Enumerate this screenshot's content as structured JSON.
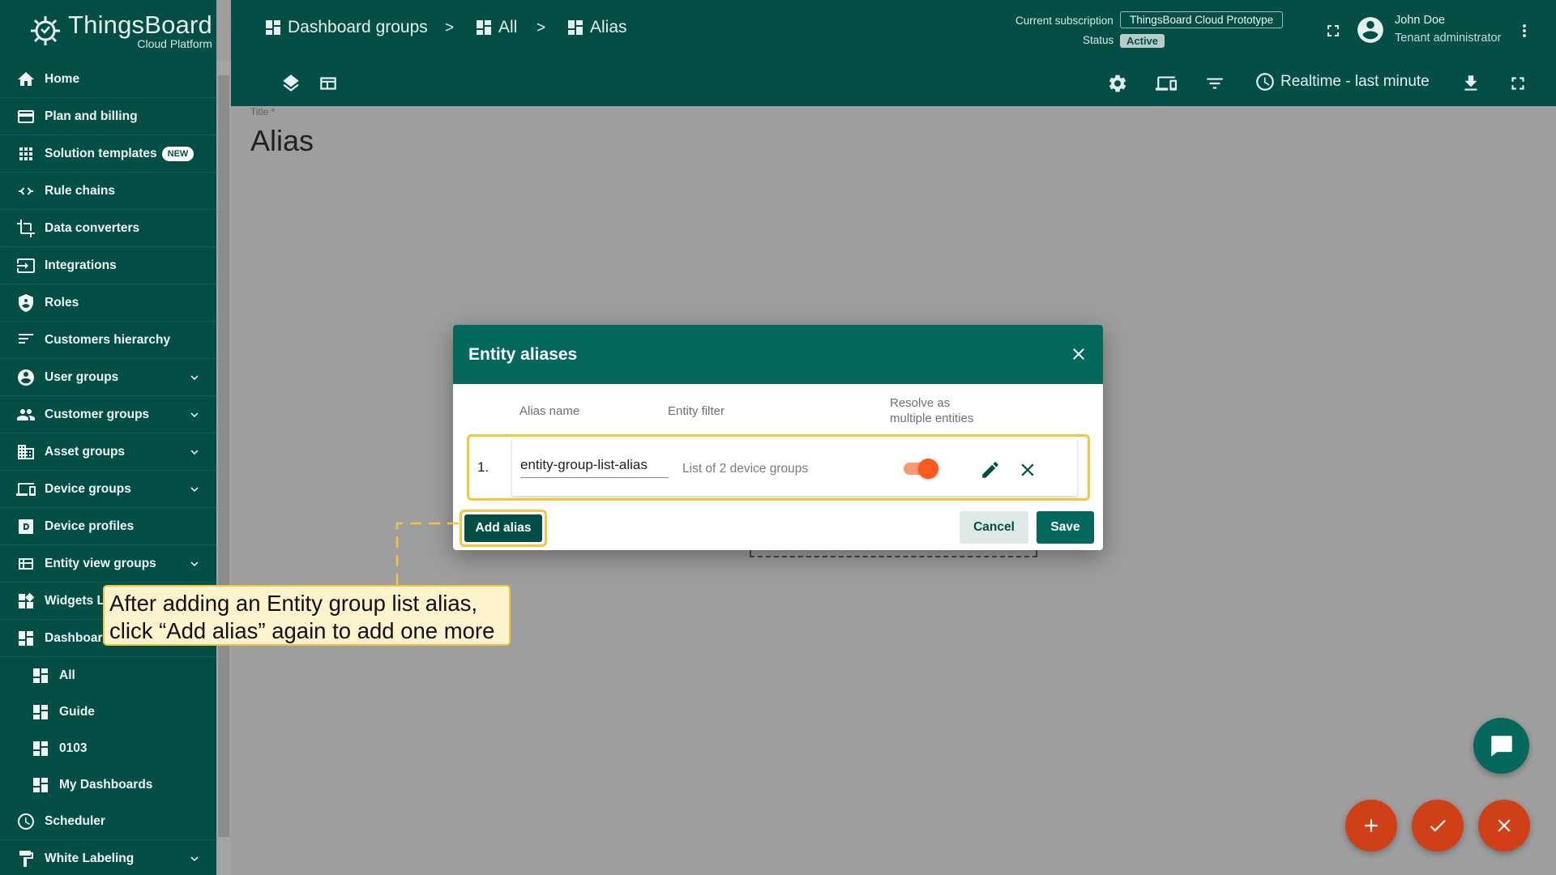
{
  "app": {
    "brand": "ThingsBoard",
    "brand_sub": "Cloud Platform"
  },
  "sidebar": {
    "items": [
      {
        "label": "Home",
        "icon": "home-icon"
      },
      {
        "label": "Plan and billing",
        "icon": "billing-icon"
      },
      {
        "label": "Solution templates",
        "icon": "apps-icon",
        "badge": "NEW"
      },
      {
        "label": "Rule chains",
        "icon": "rule-chain-icon"
      },
      {
        "label": "Data converters",
        "icon": "converter-icon"
      },
      {
        "label": "Integrations",
        "icon": "integration-icon"
      },
      {
        "label": "Roles",
        "icon": "shield-icon"
      },
      {
        "label": "Customers hierarchy",
        "icon": "hierarchy-icon"
      },
      {
        "label": "User groups",
        "icon": "account-icon"
      },
      {
        "label": "Customer groups",
        "icon": "people-icon"
      },
      {
        "label": "Asset groups",
        "icon": "domain-icon"
      },
      {
        "label": "Device groups",
        "icon": "devices-icon"
      },
      {
        "label": "Device profiles",
        "icon": "device-profile-icon"
      },
      {
        "label": "Entity view groups",
        "icon": "view-quilt-icon"
      },
      {
        "label": "Widgets L",
        "icon": "widgets-icon"
      },
      {
        "label": "Dashboard",
        "icon": "dashboard-icon"
      },
      {
        "label": "All",
        "icon": "dashboard-icon"
      },
      {
        "label": "Guide",
        "icon": "dashboard-icon"
      },
      {
        "label": "0103",
        "icon": "dashboard-icon"
      },
      {
        "label": "My Dashboards",
        "icon": "dashboard-icon"
      },
      {
        "label": "Scheduler",
        "icon": "schedule-icon"
      },
      {
        "label": "White Labeling",
        "icon": "format-paint-icon"
      }
    ]
  },
  "header": {
    "breadcrumbs": [
      "Dashboard groups",
      "All",
      "Alias"
    ],
    "separator": ">",
    "subscription_label": "Current subscription",
    "subscription_value": "ThingsBoard Cloud Prototype",
    "status_label": "Status",
    "status_value": "Active",
    "user_name": "John Doe",
    "user_role": "Tenant administrator"
  },
  "toolbar": {
    "timewindow": "Realtime - last minute"
  },
  "canvas": {
    "title_label": "Title *",
    "title_value": "Alias"
  },
  "dialog": {
    "title": "Entity aliases",
    "columns": {
      "alias_name": "Alias name",
      "entity_filter": "Entity filter",
      "resolve_line1": "Resolve as",
      "resolve_line2": "multiple entities"
    },
    "row": {
      "index": "1.",
      "alias_name": "entity-group-list-alias",
      "filter": "List of 2 device groups",
      "resolve_multiple": true
    },
    "add_alias": "Add alias",
    "cancel": "Cancel",
    "save": "Save"
  },
  "tooltip": {
    "line1": "After adding an Entity group list alias,",
    "line2": "click “Add alias” again to add one more"
  },
  "colors": {
    "primary": "#034f45",
    "dialog_header": "#04685c",
    "accent": "#fb5a1c",
    "highlight": "#f5c642"
  }
}
